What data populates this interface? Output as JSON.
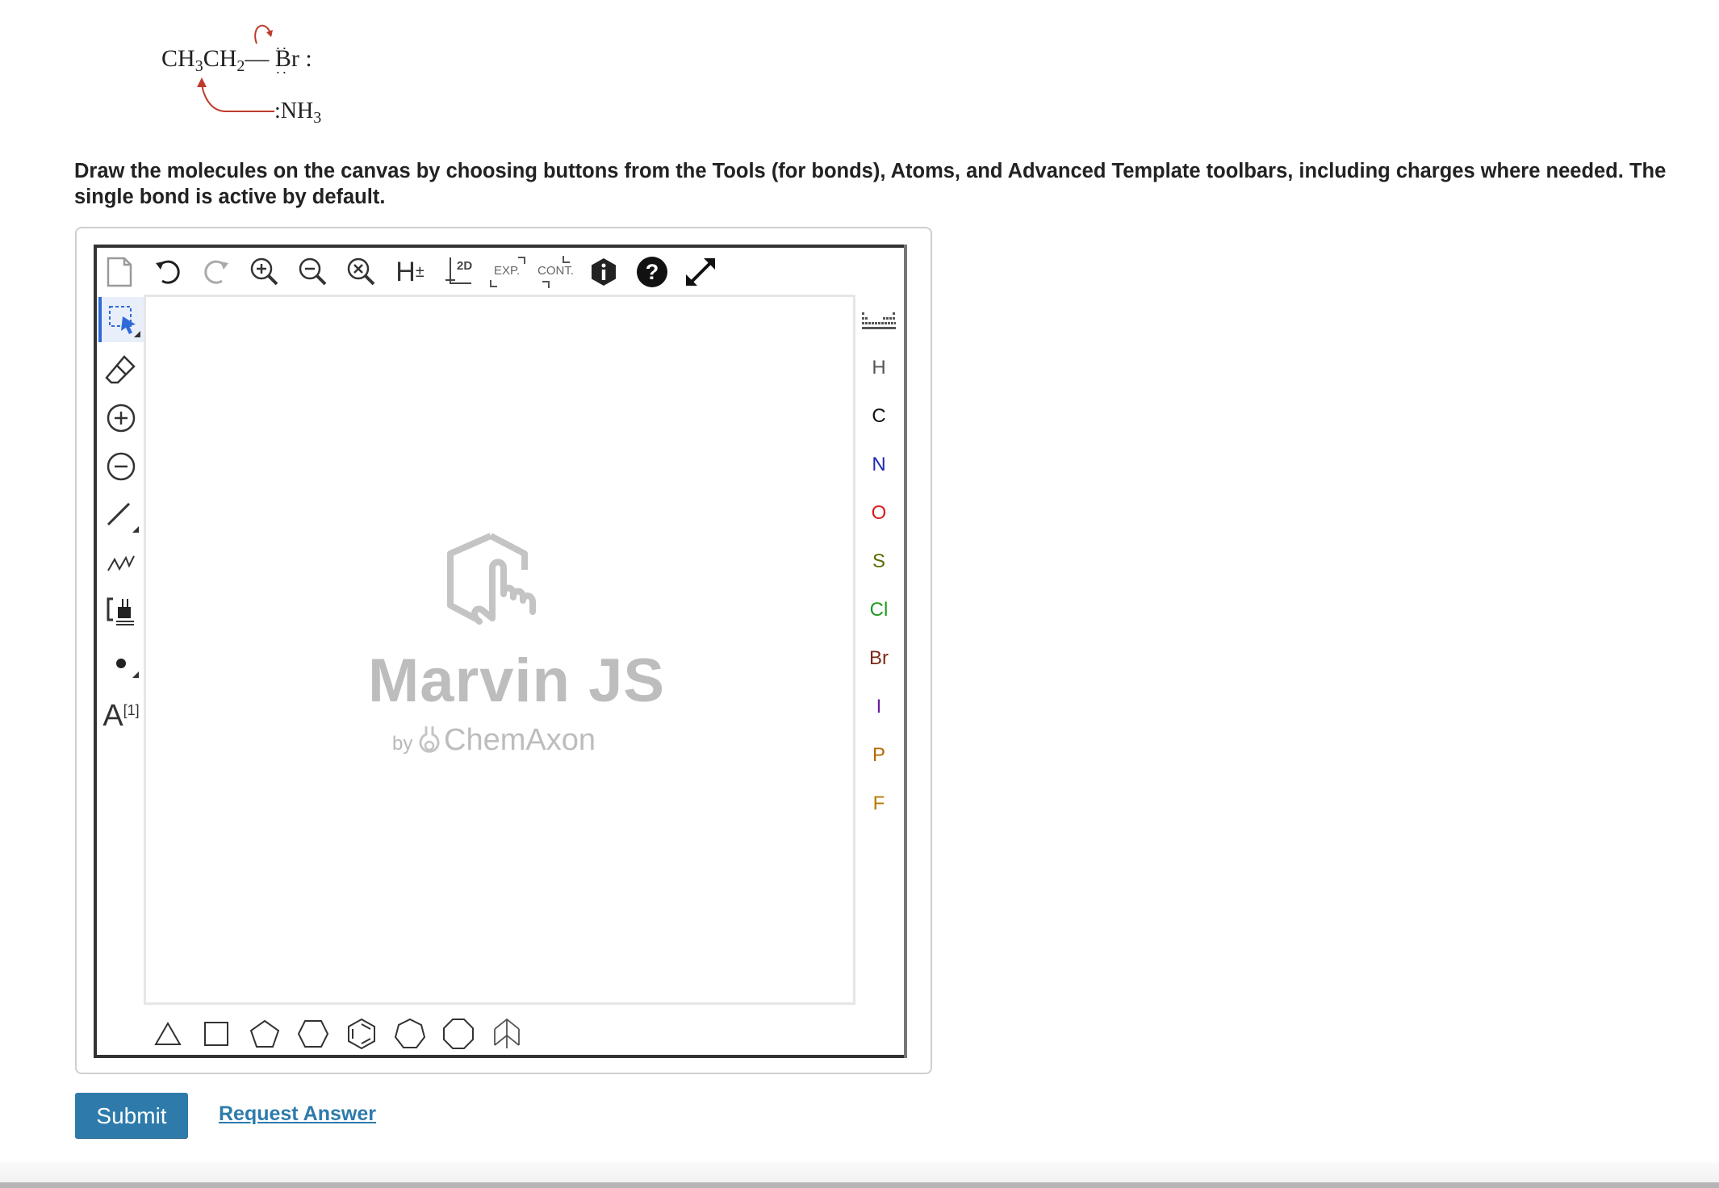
{
  "reaction": {
    "substrate_left": "CH",
    "sub1": "3",
    "substrate_mid": "CH",
    "sub2": "2",
    "bond": "—",
    "leaving_group": "Br",
    "leaving_group_suffix": ":",
    "nucleophile_prefix": ":NH",
    "sub3": "3"
  },
  "instructions": "Draw the molecules on the canvas by choosing buttons from the Tools (for bonds), Atoms, and Advanced Template toolbars, including charges where needed. The single bond is active by default.",
  "toolbar": {
    "h_toggle_label": "H",
    "h_toggle_sup": "±",
    "clean2d_label": "2D",
    "expand_label": "EXP.",
    "contract_label": "CONT."
  },
  "left_tools": {
    "atom_map_label": "A",
    "atom_map_sup": "[1]"
  },
  "atoms": [
    {
      "symbol": "H",
      "color": "#555555"
    },
    {
      "symbol": "C",
      "color": "#111111"
    },
    {
      "symbol": "N",
      "color": "#1f2bb0"
    },
    {
      "symbol": "O",
      "color": "#d51d1d"
    },
    {
      "symbol": "S",
      "color": "#5f6b00"
    },
    {
      "symbol": "Cl",
      "color": "#1e9a1e"
    },
    {
      "symbol": "Br",
      "color": "#7a2a1a"
    },
    {
      "symbol": "I",
      "color": "#6a1aa0"
    },
    {
      "symbol": "P",
      "color": "#b56a00"
    },
    {
      "symbol": "F",
      "color": "#b57a00"
    }
  ],
  "watermark": {
    "title": "Marvin JS",
    "by": "by",
    "company": "ChemAxon"
  },
  "actions": {
    "submit_label": "Submit",
    "request_label": "Request Answer"
  },
  "colors": {
    "accent": "#2e7bab",
    "active_tool": "#2f6bd8"
  }
}
